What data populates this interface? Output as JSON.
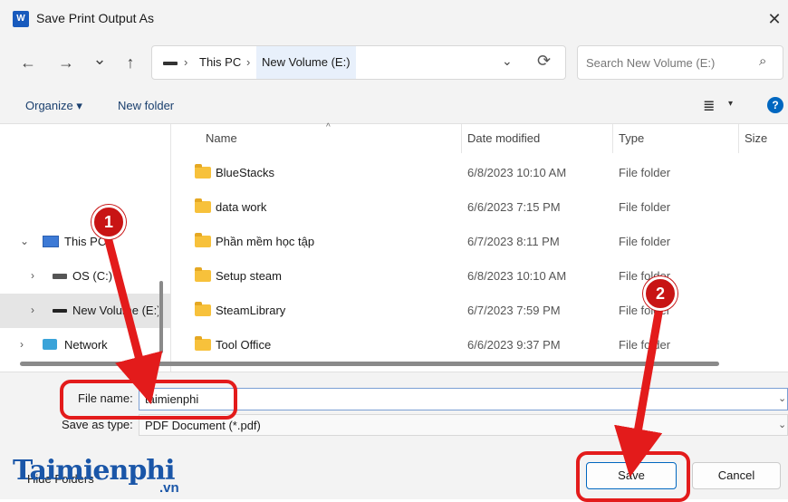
{
  "window": {
    "title": "Save Print Output As",
    "app_icon_label": "W",
    "close_glyph": "✕"
  },
  "nav": {
    "back_glyph": "←",
    "forward_glyph": "→",
    "recent_glyph": "⌄",
    "up_glyph": "↑"
  },
  "address": {
    "segments": [
      "This PC",
      "New Volume (E:)"
    ],
    "sep": "›",
    "dropdown_glyph": "⌄",
    "refresh_glyph": "⟳"
  },
  "search": {
    "placeholder": "Search New Volume (E:)",
    "icon_glyph": "⌕"
  },
  "toolbar": {
    "organize": "Organize ▾",
    "new_folder": "New folder",
    "view_glyph": "≣",
    "view_dd_glyph": "▾",
    "help_glyph": "?"
  },
  "tree": {
    "this_pc": "This PC",
    "os": "OS (C:)",
    "new_volume": "New Volume (E:)",
    "network": "Network",
    "chevron_open": "⌄",
    "chevron_closed": "›"
  },
  "columns": {
    "name": "Name",
    "date": "Date modified",
    "type": "Type",
    "size": "Size",
    "sort_glyph": "^"
  },
  "files": [
    {
      "name": "BlueStacks",
      "date": "6/8/2023 10:10 AM",
      "type": "File folder"
    },
    {
      "name": "data work",
      "date": "6/6/2023 7:15 PM",
      "type": "File folder"
    },
    {
      "name": "Phần mềm học tập",
      "date": "6/7/2023 8:11 PM",
      "type": "File folder"
    },
    {
      "name": "Setup steam",
      "date": "6/8/2023 10:10 AM",
      "type": "File folder"
    },
    {
      "name": "SteamLibrary",
      "date": "6/7/2023 7:59 PM",
      "type": "File folder"
    },
    {
      "name": "Tool Office",
      "date": "6/6/2023 9:37 PM",
      "type": "File folder"
    }
  ],
  "form": {
    "file_name_label": "File name:",
    "file_name_value": "taimienphi",
    "save_type_label": "Save as type:",
    "save_type_value": "PDF Document (*.pdf)",
    "dropdown_glyph": "⌄",
    "hide_folders": "Hide Folders"
  },
  "buttons": {
    "save": "Save",
    "cancel": "Cancel"
  },
  "annotations": {
    "step1": "1",
    "step2": "2",
    "color": "#e31b1b"
  },
  "watermark": {
    "brand": "aimienphi",
    "brand_initial": "T",
    "tld": ".vn"
  }
}
